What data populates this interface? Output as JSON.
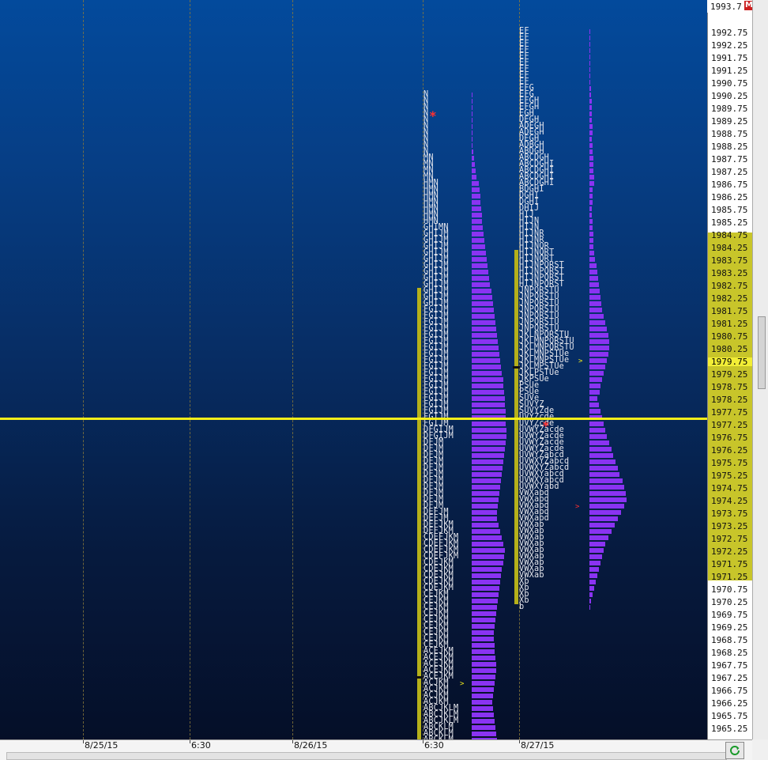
{
  "colors": {
    "letters": "#e8e8ee",
    "histogram": "#8a33f2",
    "value_area": "#b5b01a",
    "vah_line": "#f5ee1a",
    "price_axis_band": "#c8c52a",
    "highlight": "#f2ee36",
    "initiative": "#ff3030"
  },
  "price_axis": {
    "top_price": "1993.7",
    "badge": "M",
    "labels": [
      "1992.75",
      "1992.25",
      "1991.75",
      "1991.25",
      "1990.75",
      "1990.25",
      "1989.75",
      "1989.25",
      "1988.75",
      "1988.25",
      "1987.75",
      "1987.25",
      "1986.75",
      "1986.25",
      "1985.75",
      "1985.25",
      "1984.75",
      "1984.25",
      "1983.75",
      "1983.25",
      "1982.75",
      "1982.25",
      "1981.75",
      "1981.25",
      "1980.75",
      "1980.25",
      "1979.75",
      "1979.25",
      "1978.75",
      "1978.25",
      "1977.75",
      "1977.25",
      "1976.75",
      "1976.25",
      "1975.75",
      "1975.25",
      "1974.75",
      "1974.25",
      "1973.75",
      "1973.25",
      "1972.75",
      "1972.25",
      "1971.75",
      "1971.25",
      "1970.75",
      "1970.25",
      "1969.75",
      "1969.25",
      "1968.75",
      "1968.25",
      "1967.75",
      "1967.25",
      "1966.75",
      "1966.25",
      "1965.75",
      "1965.25"
    ],
    "highlighted": "1979.75",
    "value_area_high": "1984.75",
    "value_area_low": "1971.25"
  },
  "time_axis": {
    "labels": [
      "8/25/15",
      "6:30",
      "8/26/15",
      "6:30",
      "8/27/15"
    ]
  },
  "profile_1": {
    "rows": [
      "N",
      "N",
      "N",
      "N",
      "N",
      "N",
      "N",
      "N",
      "N",
      "N",
      "MN",
      "MN",
      "MN",
      "MN",
      "HMN",
      "HMN",
      "HMN",
      "HMN",
      "HMN",
      "HMN",
      "HMN",
      "GHIMN",
      "GHIJM",
      "GHIJM",
      "GHIJM",
      "GHIJM",
      "GHIJM",
      "GHIJM",
      "GHIJM",
      "GHIJM",
      "GHIJM",
      "GHIJM",
      "GHIJM",
      "GHIJM",
      "FGIJM",
      "FGIJM",
      "FGIJM",
      "FGIJM",
      "FGIJM",
      "FGIJM",
      "FGIJM",
      "FGIJM",
      "FGIJM",
      "FGIJM",
      "FGIJM",
      "FGIJM",
      "FGIJM",
      "FGIJM",
      "FGIJM",
      "FGIJM",
      "FGIJM",
      "FGIJM",
      "FGIJM",
      "DFGIJM",
      "DFGIJM",
      "DFJM",
      "DFJM",
      "DFJM",
      "DFJM",
      "DFJM",
      "DFJM",
      "DFJM",
      "DFJM",
      "DFJM",
      "DFJM",
      "DFJM",
      "DEFJM",
      "DEFJM",
      "DEFJKM",
      "DEFJKM",
      "CDEFJKM",
      "CDEFJKM",
      "CDEFJKM",
      "CDEFJKM",
      "CDEJKM",
      "CDEJKM",
      "CDEJKM",
      "CDEJKM",
      "CDEJKM",
      "CEJKM",
      "CEJKM",
      "CEJKM",
      "CEJKM",
      "CEJKM",
      "CEJKM",
      "CEJKM",
      "CEJKM",
      "CEJKM",
      "ACEJKM",
      "ACEJKM",
      "ACEJKM",
      "ACEJKM",
      "ACEJKM",
      "ACJKM",
      "ACJKM",
      "ACJKM",
      "ACJKM",
      "ABCJKLM",
      "ABCJKLM",
      "ABCJKLM",
      "ABCKLM",
      "ABCKLM",
      "ABCKLM",
      "ABCKLM",
      "ABCKLM",
      "ABCKLM",
      "ABCKLM",
      "ABCKLM"
    ],
    "hist": [
      1,
      1,
      1,
      1,
      1,
      1,
      1,
      1,
      1,
      2,
      3,
      4,
      5,
      6,
      9,
      10,
      11,
      11,
      12,
      13,
      13,
      14,
      15,
      16,
      17,
      18,
      19,
      20,
      21,
      22,
      23,
      25,
      26,
      27,
      28,
      29,
      30,
      31,
      32,
      33,
      34,
      35,
      36,
      37,
      38,
      40,
      40,
      41,
      42,
      42,
      43,
      43,
      43,
      44,
      44,
      43,
      42,
      41,
      40,
      39,
      38,
      37,
      36,
      35,
      34,
      33,
      32,
      32,
      34,
      36,
      38,
      40,
      42,
      41,
      40,
      38,
      37,
      36,
      35,
      34,
      33,
      32,
      31,
      30,
      29,
      28,
      28,
      29,
      29,
      30,
      31,
      31,
      30,
      29,
      28,
      27,
      26,
      27,
      28,
      29,
      30,
      31,
      32,
      33,
      34,
      35,
      36,
      37
    ],
    "va_bar_top_row": 31,
    "va_bar_bottom_row": 107,
    "poc_row": 92
  },
  "profile_2": {
    "rows": [
      "EF",
      "EF",
      "EF",
      "EF",
      "EF",
      "EF",
      "EF",
      "EF",
      "EF",
      "EFG",
      "EFG",
      "EFGH",
      "EFGH",
      "EGH",
      "DEGH",
      "ADEGH",
      "ADEGH",
      "DEGH",
      "ADBGH",
      "ABDGH",
      "ABCDGH",
      "ABCDGHI",
      "ABCDGHI",
      "ABCDGHI",
      "ABCDGHI",
      "BDGHI",
      "DGHI",
      "DGHI",
      "DHIJ",
      "HIJ",
      "HIJN",
      "HIJN",
      "HIJNR",
      "HIJNR",
      "HIJNQR",
      "HIJNQRT",
      "HIJNQRT",
      "HIJNPQRST",
      "HIJNPQRST",
      "HIJNPQRST",
      "HIJNPQRST",
      "JNPQRSTU",
      "JNPQRSTU",
      "JNPQRSTU",
      "JNPQRSTU",
      "JNPQRSTU",
      "JNPQRSTU",
      "JNPQRSTU",
      "JKLNPQRSTU",
      "JKLMNPQRSTU",
      "JKLMNPQRSTU",
      "JKLMNPSTUe",
      "JKLMNPSTUe",
      "JKLMPSTUe",
      "JKLPSTUe",
      "JKPSUe",
      "PSUe",
      "PSUe",
      "SUVe",
      "SUVYZ",
      "SUVYZde",
      "UVYZcde",
      "UVYZcde",
      "UVWYZacde",
      "UVWYZacde",
      "UVWYZacde",
      "UVWYZacde",
      "UVWYZabcd",
      "UVWXYZabcd",
      "UVWXYZabcd",
      "UVWXYabcd",
      "UVWXYabcd",
      "UVWXYabd",
      "VWXabd",
      "VWXabd",
      "VWXabd",
      "VWXabd",
      "VWXabd",
      "VWXab",
      "VWXab",
      "VWXab",
      "VWXab",
      "VWXab",
      "VWXab",
      "VWXab",
      "VWXab",
      "VWXab",
      "Xb",
      "Xb",
      "Xb",
      "Xb",
      "b"
    ],
    "hist": [
      1,
      1,
      1,
      1,
      1,
      1,
      1,
      1,
      1,
      2,
      2,
      3,
      3,
      3,
      3,
      4,
      4,
      3,
      4,
      4,
      5,
      5,
      5,
      6,
      6,
      4,
      4,
      4,
      3,
      3,
      4,
      4,
      5,
      5,
      5,
      6,
      7,
      9,
      10,
      11,
      12,
      13,
      14,
      15,
      16,
      18,
      20,
      22,
      24,
      25,
      25,
      24,
      22,
      20,
      18,
      16,
      14,
      13,
      10,
      12,
      14,
      16,
      18,
      20,
      22,
      25,
      28,
      30,
      33,
      36,
      38,
      42,
      44,
      46,
      47,
      44,
      40,
      36,
      32,
      28,
      24,
      20,
      18,
      16,
      14,
      12,
      10,
      8,
      6,
      4,
      2,
      1
    ],
    "va_bar_top_row": 35,
    "va_bar_bottom_row": 90,
    "poc_row": 53
  }
}
